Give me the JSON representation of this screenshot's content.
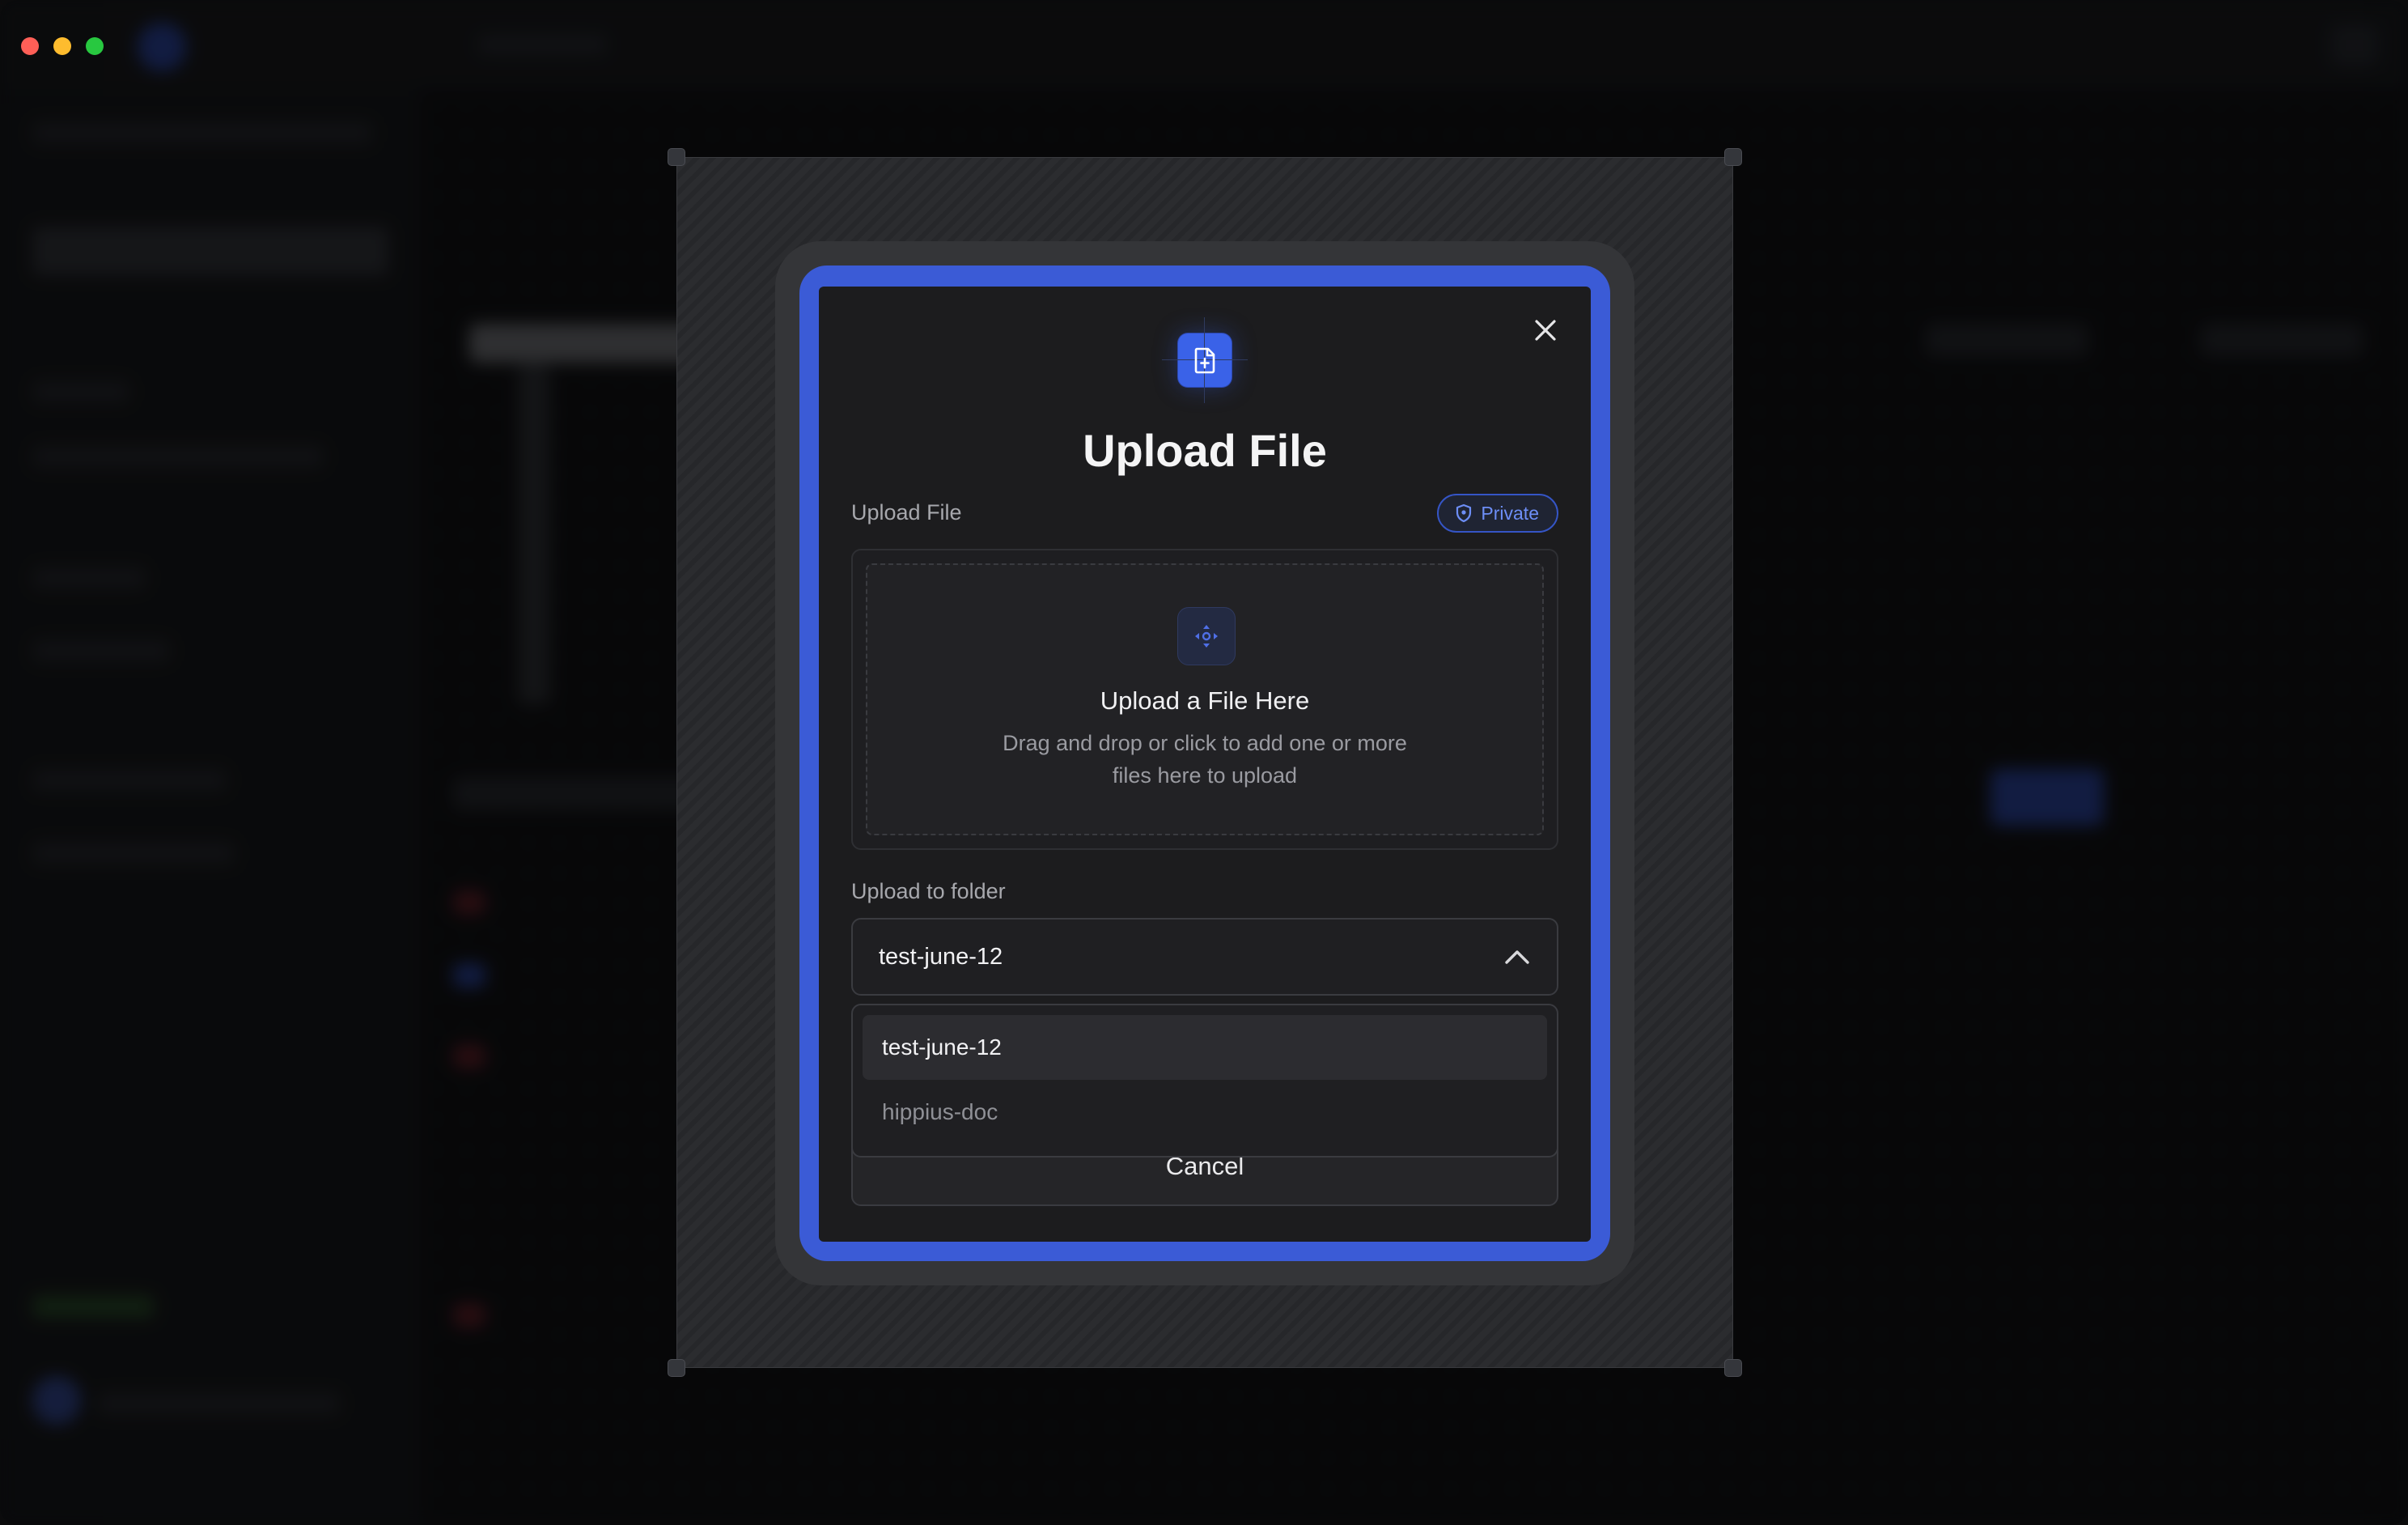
{
  "window": {
    "controls": [
      "close",
      "minimize",
      "zoom"
    ]
  },
  "modal": {
    "title": "Upload File",
    "close_icon": "close-icon",
    "header_icon": "file-upload-icon",
    "upload_section_label": "Upload File",
    "privacy_badge": {
      "label": "Private",
      "icon": "shield-icon"
    },
    "dropzone": {
      "icon": "upload-target-icon",
      "title": "Upload a File Here",
      "subtitle": "Drag and drop or click to add one or more files here to upload"
    },
    "folder": {
      "label": "Upload to folder",
      "selected": "test-june-12",
      "icon": "chevron-up-icon",
      "options": [
        "test-june-12",
        "hippius-doc"
      ]
    },
    "cancel_label": "Cancel"
  },
  "colors": {
    "accent": "#3b5bd6",
    "icon_blue": "#3a62e8",
    "badge_text": "#6d8ef6",
    "modal_bg": "#1c1c1e"
  }
}
